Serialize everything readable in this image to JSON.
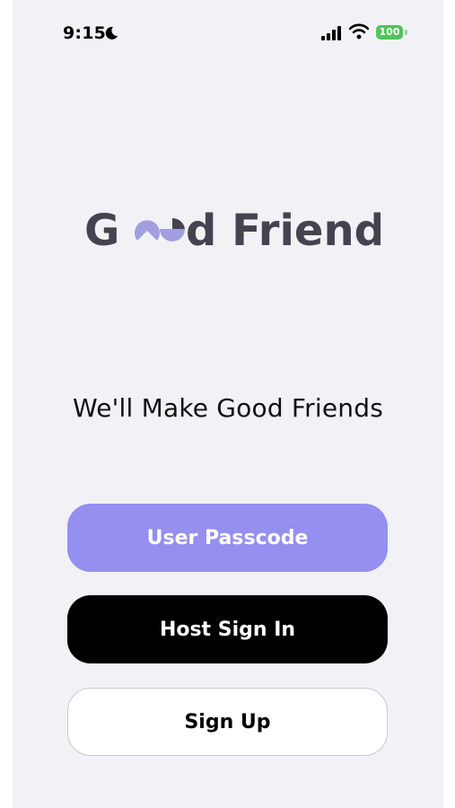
{
  "status_bar": {
    "time": "9:15",
    "battery": "100",
    "icons": [
      "moon-icon",
      "signal-icon",
      "wifi-icon",
      "battery-icon"
    ]
  },
  "logo": {
    "prefix": "G",
    "suffix": "d Friend",
    "mark_color": "#a29ee0",
    "text_color": "#45434f"
  },
  "tagline": "We'll Make Good Friends",
  "buttons": {
    "user_passcode": "User Passcode",
    "host_sign_in": "Host Sign In",
    "sign_up": "Sign Up"
  },
  "colors": {
    "background": "#f2f1f6",
    "primary_accent": "#958ff0",
    "host_button": "#000000",
    "signup_button": "#ffffff",
    "battery": "#53c25b"
  }
}
